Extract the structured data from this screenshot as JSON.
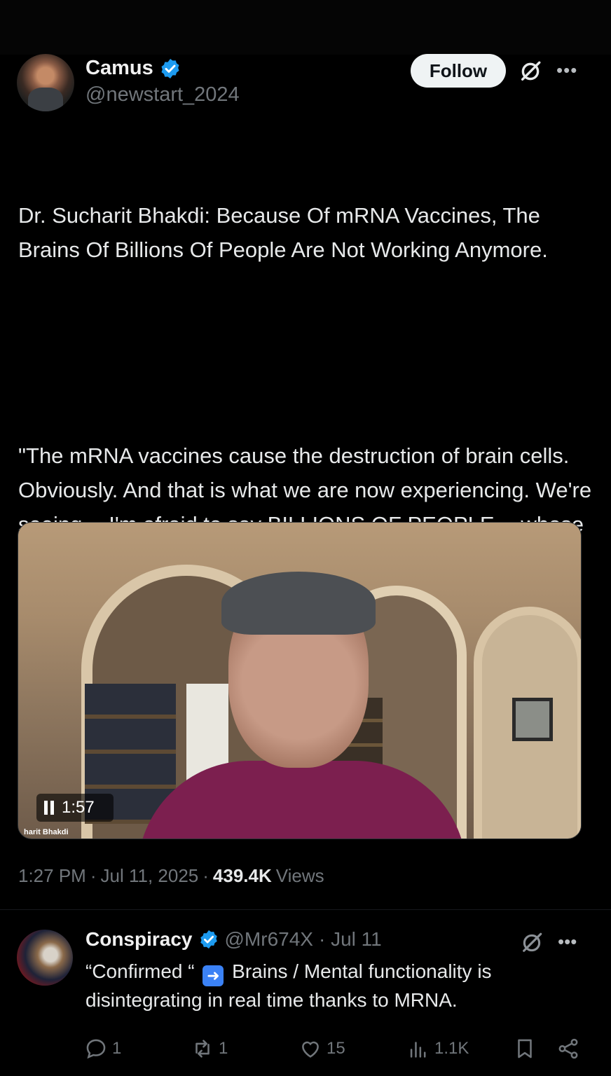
{
  "post": {
    "author": {
      "display_name": "Camus",
      "handle": "@newstart_2024",
      "verified": true
    },
    "follow_label": "Follow",
    "text_paragraphs": [
      "Dr. Sucharit Bhakdi: Because Of mRNA Vaccines, The Brains Of Billions Of People Are Not Working Anymore.",
      "\"The mRNA vaccines cause the destruction of brain cells. Obviously. And that is what we are now experiencing. We're seeing -- I'm afraid to say BILLIONS OF PEOPLE -- whose brains are not working anymore. Not as they should be. They are altered. And they don't have the willpower anymore. They don't have the intelligence anymore...\""
    ],
    "media": {
      "type": "video",
      "time_remaining": "1:57",
      "caption_fragment": "harit Bhakdi",
      "state": "playing"
    },
    "meta": {
      "time": "1:27 PM",
      "date": "Jul 11, 2025",
      "views_count": "439.4K",
      "views_label": "Views",
      "separator": "·"
    }
  },
  "reply": {
    "author": {
      "display_name": "Conspiracy",
      "handle": "@Mr674X",
      "verified": true
    },
    "date": "· Jul 11",
    "text_before_emoji": "“Confirmed “",
    "emoji": "➡️",
    "text_after_emoji": "Brains / Mental functionality is disintegrating in real time thanks to MRNA.",
    "actions": {
      "replies": "1",
      "reposts": "1",
      "likes": "15",
      "views": "1.1K"
    }
  },
  "colors": {
    "background": "#000000",
    "text_primary": "#e7e9ea",
    "text_secondary": "#71767b",
    "verified_blue": "#1d9bf0",
    "follow_button_bg": "#eff3f4"
  },
  "icons": [
    "verified-badge-icon",
    "grok-icon",
    "more-icon",
    "pause-icon",
    "reply-icon",
    "repost-icon",
    "like-icon",
    "views-icon",
    "bookmark-icon",
    "share-icon"
  ]
}
